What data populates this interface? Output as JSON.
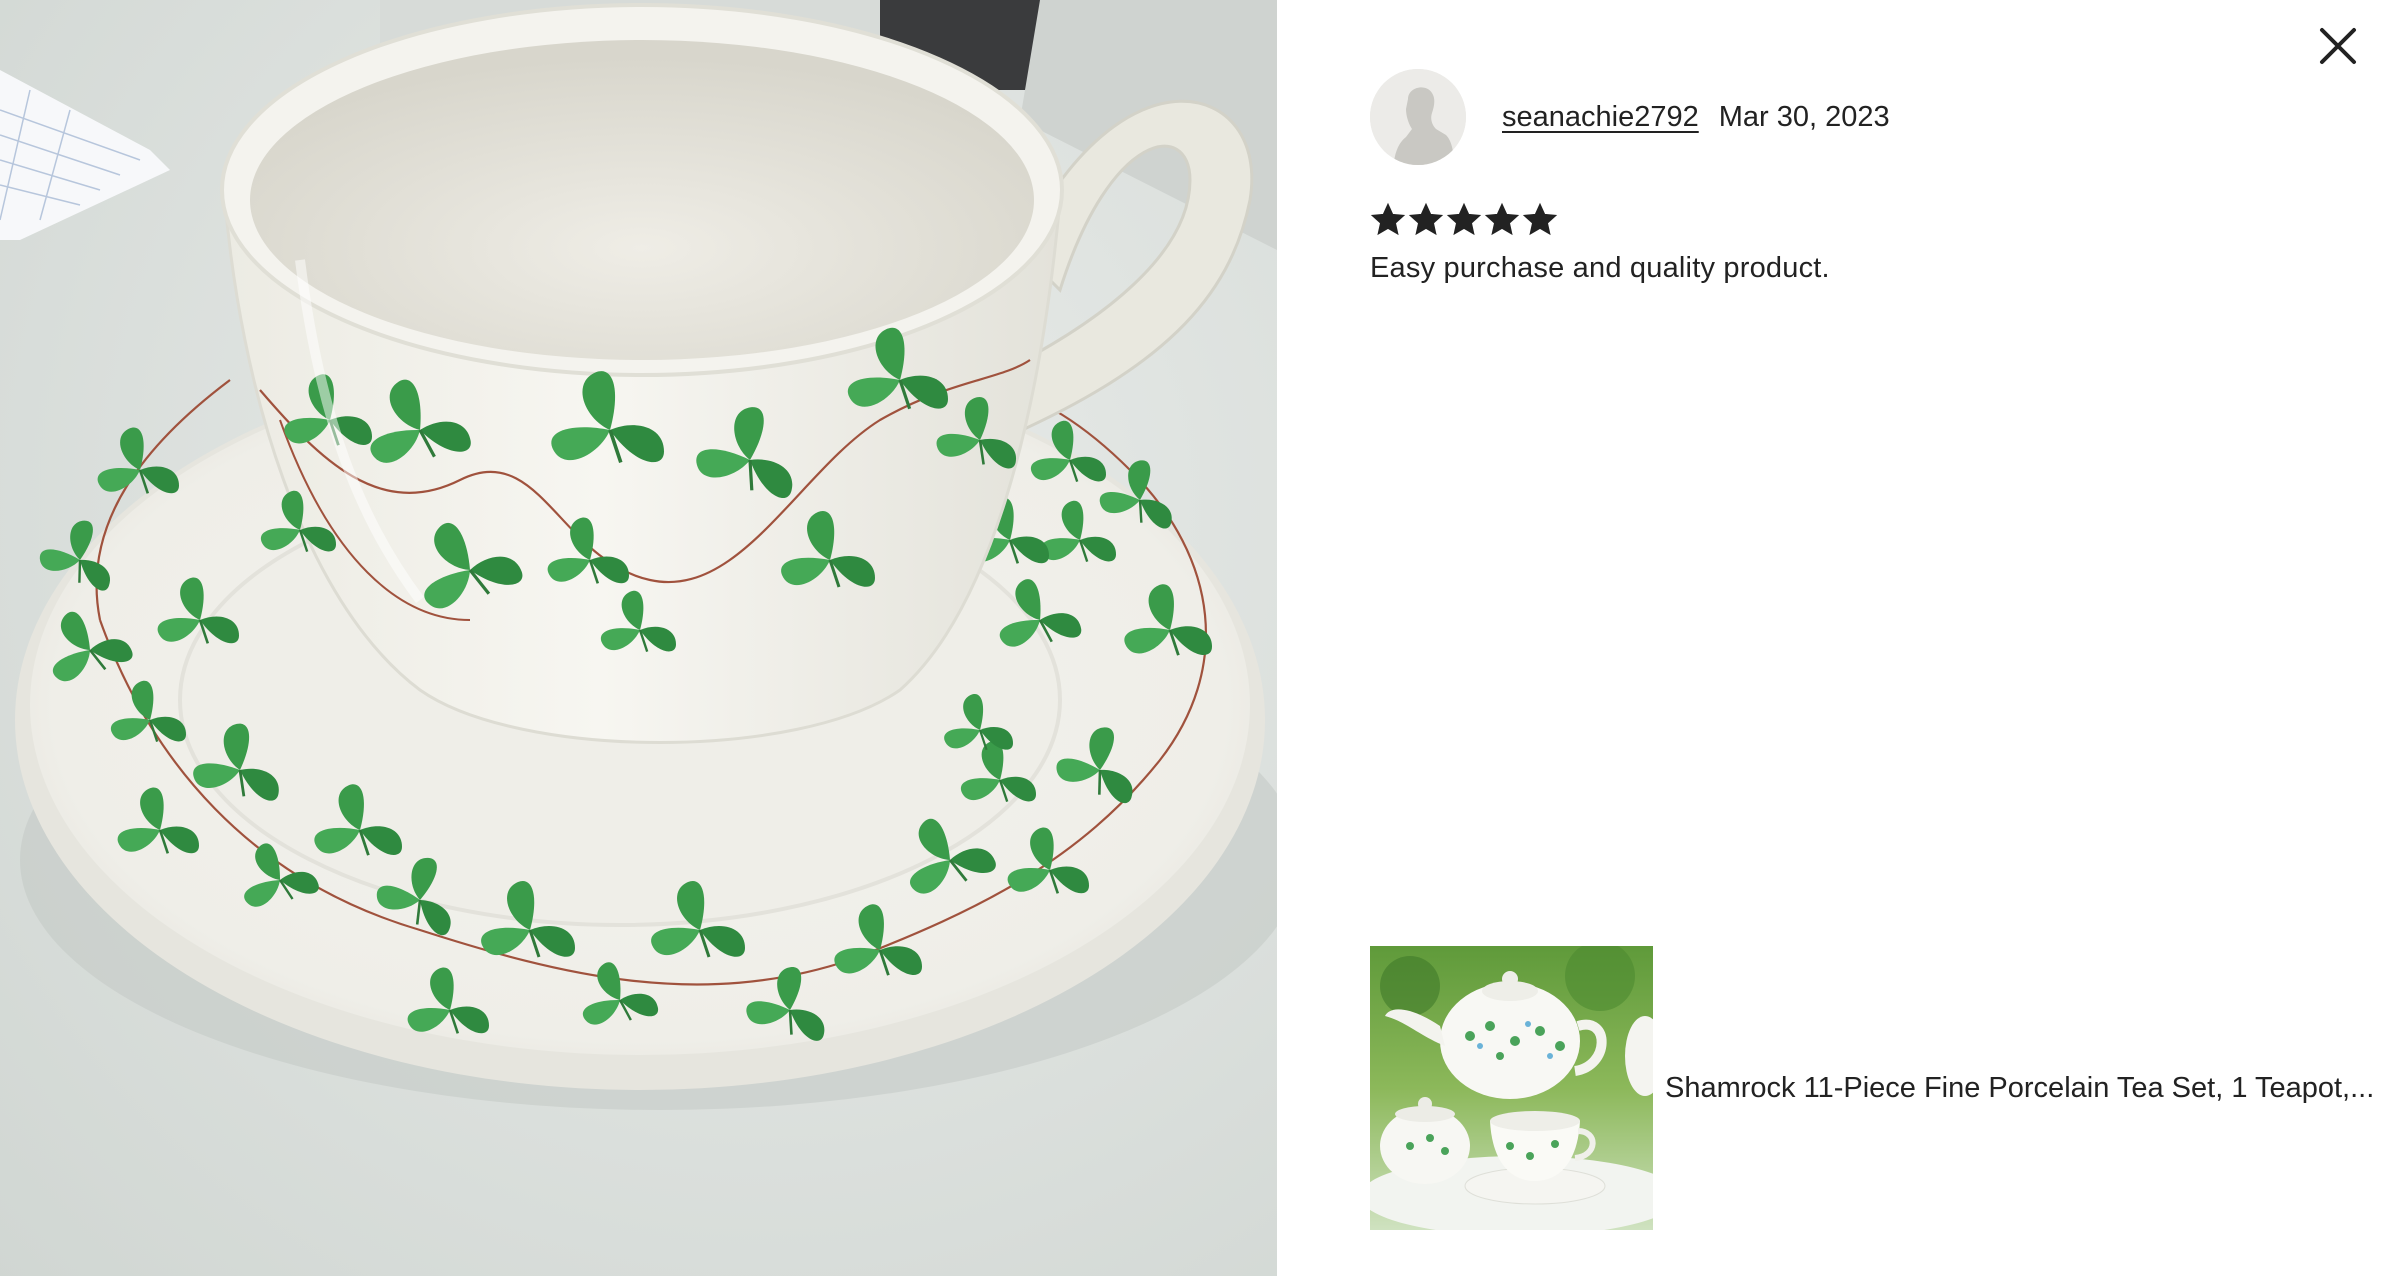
{
  "dialog": {
    "close_icon": "close-icon"
  },
  "review": {
    "username": "seanachie2792",
    "date": "Mar 30, 2023",
    "rating": 5,
    "rating_max": 5,
    "text": "Easy purchase and quality product.",
    "avatar_icon": "default-avatar-silhouette"
  },
  "photo": {
    "subject": "review-photo"
  },
  "listing": {
    "title": "Shamrock 11-Piece Fine Porcelain Tea Set, 1 Teapot,..."
  },
  "colors": {
    "text": "#222222",
    "star": "#222222",
    "shamrock_green": "#3a9b4a",
    "vine_red": "#a0523d"
  }
}
